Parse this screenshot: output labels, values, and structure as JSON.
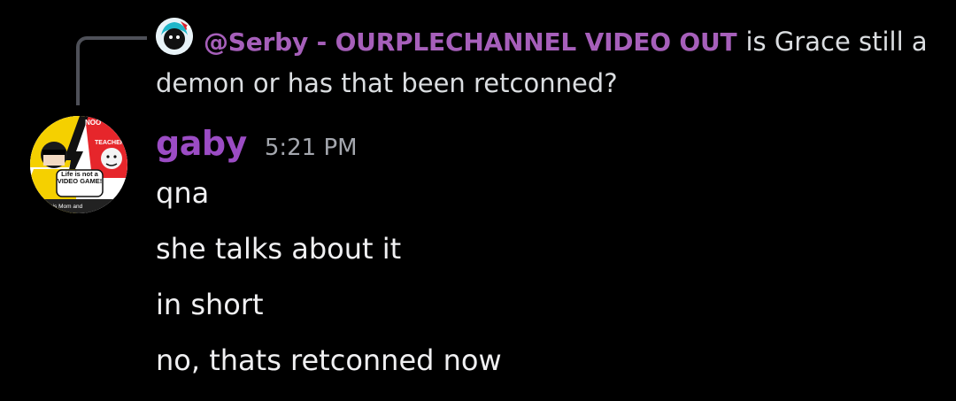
{
  "reply": {
    "author": "@Serby - OURPLECHANNEL VIDEO OUT",
    "text": "is Grace still a demon or has that been retconned?"
  },
  "message": {
    "author": "gaby",
    "timestamp": "5:21 PM",
    "avatar_text": {
      "top": "NOO",
      "teacher": "TEACHER",
      "caption": "Life is not a VIDEO GAME!",
      "year": "20",
      "bottom": "his Mom and"
    },
    "lines": [
      "qna",
      "she talks about it",
      "in short",
      "no, thats retconned now"
    ]
  },
  "colors": {
    "background": "#000000",
    "reply_author": "#a65fba",
    "author": "#9b4cc4",
    "text": "#f0f0f2",
    "timestamp": "#a4a7ae",
    "spine": "#4e5058"
  }
}
